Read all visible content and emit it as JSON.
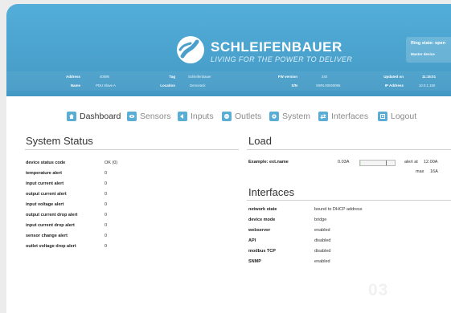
{
  "brand": {
    "name": "SCHLEIFENBAUER",
    "tagline": "LIVING FOR THE POWER TO DELIVER"
  },
  "ring": {
    "state_label": "Ring state: open",
    "role": "Master device"
  },
  "device_info": {
    "address_label": "Address",
    "address": "40095",
    "name_label": "Name",
    "name": "PDU Slave A",
    "tag_label": "Tag",
    "tag": "Schleifenbauer",
    "location_label": "Location",
    "location": "Demorack",
    "fw_label": "FW version",
    "fw": "240",
    "sn_label": "S/N",
    "sn": "SWN.00040095",
    "updated_label": "Updated on",
    "updated": "11:15:01",
    "ip_label": "IP Address",
    "ip": "10.0.1.150"
  },
  "nav": {
    "items": [
      {
        "label": "Dashboard",
        "icon": "home-icon"
      },
      {
        "label": "Sensors",
        "icon": "eye-icon"
      },
      {
        "label": "Inputs",
        "icon": "plug-icon"
      },
      {
        "label": "Outlets",
        "icon": "outlet-icon"
      },
      {
        "label": "System",
        "icon": "gear-icon"
      },
      {
        "label": "Interfaces",
        "icon": "arrows-icon"
      },
      {
        "label": "Logout",
        "icon": "logout-icon"
      }
    ]
  },
  "system_status": {
    "title": "System Status",
    "rows": [
      {
        "label": "device status code",
        "value": "OK (0)"
      },
      {
        "label": "temperature alert",
        "value": "0"
      },
      {
        "label": "input current alert",
        "value": "0"
      },
      {
        "label": "output current alert",
        "value": "0"
      },
      {
        "label": "input voltage alert",
        "value": "0"
      },
      {
        "label": "output current drop alert",
        "value": "0"
      },
      {
        "label": "input current drop alert",
        "value": "0"
      },
      {
        "label": "sensor change alert",
        "value": "0"
      },
      {
        "label": "outlet voltage drop alert",
        "value": "0"
      }
    ]
  },
  "load": {
    "title": "Load",
    "name": "Example: ext.name",
    "current": "0.03A",
    "fill_fraction": 0.003,
    "alert_text": "alert at",
    "alert_value": "12.00A",
    "max_text": "max",
    "max_value": "16A"
  },
  "interfaces": {
    "title": "Interfaces",
    "rows": [
      {
        "label": "network state",
        "value": "bound to DHCP address"
      },
      {
        "label": "device mode",
        "value": "bridge"
      },
      {
        "label": "webserver",
        "value": "enabled"
      },
      {
        "label": "API",
        "value": "disabled"
      },
      {
        "label": "modbus TCP",
        "value": "disabled"
      },
      {
        "label": "SNMP",
        "value": "enabled"
      }
    ]
  },
  "watermark": "03",
  "colors": {
    "header": "#4ba3cf",
    "accent_icon": "#5aaed6",
    "page_bg": "#ececec"
  }
}
